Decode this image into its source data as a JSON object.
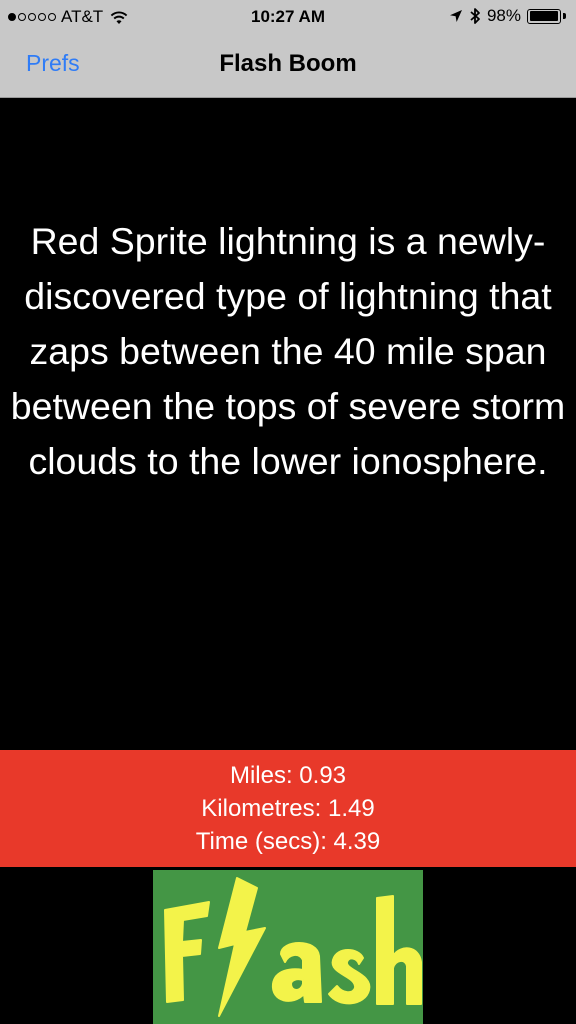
{
  "status_bar": {
    "carrier": "AT&T",
    "time": "10:27 AM",
    "battery": "98%",
    "battery_level": 0.98,
    "signal_bars_filled": 1,
    "signal_bars_total": 5
  },
  "nav": {
    "back_label": "Prefs",
    "title": "Flash Boom"
  },
  "fact": {
    "text": "Red Sprite lightning is a newly-discovered type of lightning that zaps between the 40 mile span between the tops of severe storm clouds to the lower ionosphere."
  },
  "stats": {
    "miles": "Miles: 0.93",
    "kilometres": "Kilometres: 1.49",
    "time": "Time (secs): 4.39"
  },
  "logo": {
    "text": "Flash",
    "colors": {
      "background": "#449645",
      "letters": "#f3f34a"
    }
  },
  "colors": {
    "nav_background": "#c8c8c8",
    "link": "#2f7cf6",
    "stats_background": "#e8392a",
    "main_background": "#000000"
  }
}
